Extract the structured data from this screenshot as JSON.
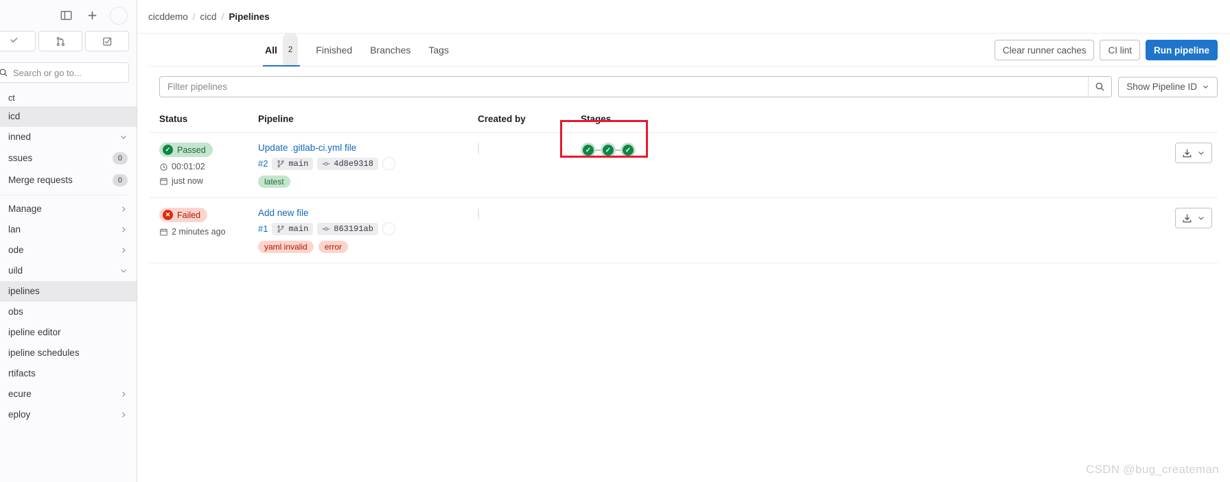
{
  "sidebar": {
    "topbar": {
      "toggle_icon": "sidebar-toggle-icon",
      "new_icon": "plus-icon",
      "avatar": "user-avatar"
    },
    "quick_buttons": [
      {
        "icon": "issues-icon",
        "name": "issues-shortcut"
      },
      {
        "icon": "merge-request-icon",
        "name": "merge-requests-shortcut"
      },
      {
        "icon": "todo-checkbox-icon",
        "name": "todos-shortcut"
      }
    ],
    "search": {
      "placeholder": "Search or go to...",
      "icon": "search-icon"
    },
    "section_label": "ct",
    "project": "icd",
    "items": [
      {
        "label": "inned",
        "badge": "",
        "chevron": "down"
      },
      {
        "label": "ssues",
        "badge": "0",
        "chevron": ""
      },
      {
        "label": "Merge requests",
        "badge": "0",
        "chevron": ""
      },
      {
        "label": "Manage",
        "badge": "",
        "chevron": "right"
      },
      {
        "label": "lan",
        "badge": "",
        "chevron": "right"
      },
      {
        "label": "ode",
        "badge": "",
        "chevron": "right"
      },
      {
        "label": "uild",
        "badge": "",
        "chevron": "down"
      },
      {
        "label": "ipelines",
        "badge": "",
        "chevron": "",
        "active": true
      },
      {
        "label": "obs",
        "badge": "",
        "chevron": ""
      },
      {
        "label": "ipeline editor",
        "badge": "",
        "chevron": ""
      },
      {
        "label": "ipeline schedules",
        "badge": "",
        "chevron": ""
      },
      {
        "label": "rtifacts",
        "badge": "",
        "chevron": ""
      },
      {
        "label": "ecure",
        "badge": "",
        "chevron": "right"
      },
      {
        "label": "eploy",
        "badge": "",
        "chevron": "right"
      }
    ]
  },
  "breadcrumb": {
    "group": "cicddemo",
    "project": "cicd",
    "current": "Pipelines",
    "separator": "/"
  },
  "tabs": [
    {
      "label": "All",
      "count": "2",
      "active": true
    },
    {
      "label": "Finished",
      "count": "",
      "active": false
    },
    {
      "label": "Branches",
      "count": "",
      "active": false
    },
    {
      "label": "Tags",
      "count": "",
      "active": false
    }
  ],
  "actions": {
    "clear_caches": "Clear runner caches",
    "ci_lint": "CI lint",
    "run_pipeline": "Run pipeline"
  },
  "filter": {
    "placeholder": "Filter pipelines",
    "value": "",
    "search_icon": "search-icon",
    "sort_label": "Show Pipeline ID",
    "sort_chevron": "chevron-down-icon"
  },
  "table": {
    "headers": [
      "Status",
      "Pipeline",
      "Created by",
      "Stages",
      ""
    ],
    "rows": [
      {
        "status": {
          "label": "Passed",
          "type": "passed",
          "icon": "check-circle-icon"
        },
        "duration": {
          "icon": "clock-icon",
          "text": "00:01:02"
        },
        "finished": {
          "icon": "calendar-icon",
          "text": "just now"
        },
        "title": "Update .gitlab-ci.yml file",
        "pipeline_id": "#2",
        "branch": {
          "icon": "branch-icon",
          "name": "main"
        },
        "commit": {
          "icon": "commit-icon",
          "sha": "4d8e9318"
        },
        "tags": [
          {
            "label": "latest",
            "color": "green"
          }
        ],
        "stages": [
          {
            "status": "success",
            "icon": "check-icon"
          },
          {
            "status": "success",
            "icon": "check-icon"
          },
          {
            "status": "success",
            "icon": "check-icon"
          }
        ],
        "highlighted": true,
        "download": {
          "icon": "download-icon",
          "chevron": "chevron-down-icon"
        }
      },
      {
        "status": {
          "label": "Failed",
          "type": "failed",
          "icon": "x-circle-icon"
        },
        "duration": null,
        "finished": {
          "icon": "calendar-icon",
          "text": "2 minutes ago"
        },
        "title": "Add new file",
        "pipeline_id": "#1",
        "branch": {
          "icon": "branch-icon",
          "name": "main"
        },
        "commit": {
          "icon": "commit-icon",
          "sha": "863191ab"
        },
        "tags": [
          {
            "label": "yaml invalid",
            "color": "red"
          },
          {
            "label": "error",
            "color": "red"
          }
        ],
        "stages": [],
        "highlighted": false,
        "download": {
          "icon": "download-icon",
          "chevron": "chevron-down-icon"
        }
      }
    ]
  },
  "watermark": "CSDN @bug_createman",
  "colors": {
    "accent": "#1f75cb",
    "link": "#1068bf",
    "success": "#108548",
    "success_bg": "#c3e6cd",
    "danger": "#dd2b0e",
    "danger_bg": "#fdd4cd",
    "highlight_box": "#e8192b"
  }
}
